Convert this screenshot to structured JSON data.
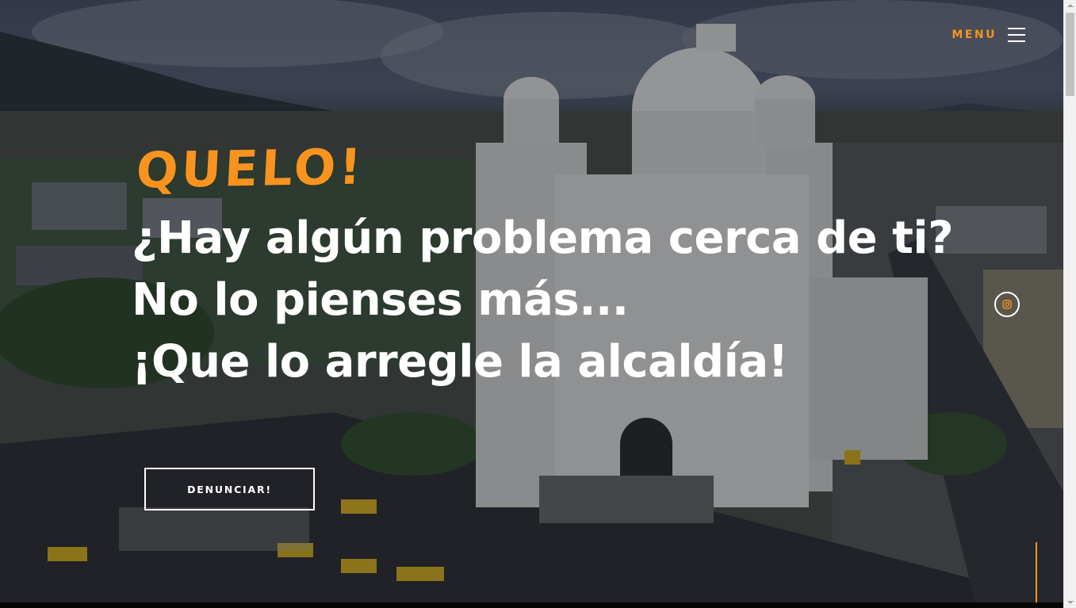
{
  "brand": {
    "name": "QUELO!"
  },
  "menu": {
    "label": "MENU",
    "icon": "hamburger-icon"
  },
  "hero": {
    "line1": "¿Hay algún problema cerca de ti?",
    "line2": "No lo pienses más...",
    "line3": "¡Que lo arregle la alcaldía!"
  },
  "cta": {
    "label": "DENUNCIAR!"
  },
  "social": {
    "icon": "instagram-icon"
  },
  "colors": {
    "accent": "#f7931e",
    "text": "#ffffff"
  }
}
